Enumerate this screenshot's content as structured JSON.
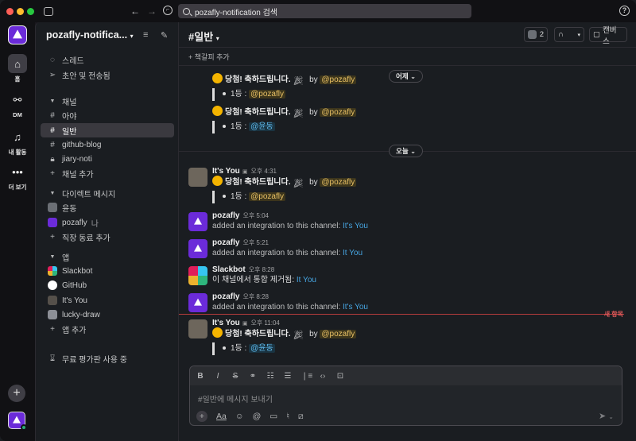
{
  "search": {
    "text": "pozafly-notification 검색"
  },
  "rail": {
    "items": [
      {
        "label": "홈",
        "icon": "home-icon"
      },
      {
        "label": "DM",
        "icon": "dm-icon"
      },
      {
        "label": "내 활동",
        "icon": "bell-icon"
      },
      {
        "label": "더 보기",
        "icon": "more-icon"
      }
    ]
  },
  "workspace": {
    "name": "pozafly-notifica...",
    "accent": "#6b2bd9"
  },
  "sidebar": {
    "threads": "스레드",
    "drafts": "초안 및 전송됨",
    "channels_header": "채널",
    "channels": [
      "아야",
      "일반",
      "github-blog",
      "jiary-noti"
    ],
    "add_channel": "채널 추가",
    "dm_header": "다이렉트 메시지",
    "dms": [
      "윤동",
      "pozafly"
    ],
    "me_tag": "나",
    "add_coworker": "직장 동료 추가",
    "apps_header": "앱",
    "apps": [
      "Slackbot",
      "GitHub",
      "It's You",
      "lucky-draw"
    ],
    "add_app": "앱 추가",
    "trial": "무료 평가판 사용 중"
  },
  "channel": {
    "name": "일반",
    "huddle_count": "2",
    "canvas": "캔버스",
    "bookmark": "책갈피 추가"
  },
  "pills": {
    "yesterday": "어제",
    "today": "오늘"
  },
  "messages": {
    "prev1": {
      "text": "당첨! 축하드립니다.",
      "by": "by",
      "mention": "@pozafly",
      "rank": "1등 :",
      "winner": "@pozafly"
    },
    "prev2": {
      "text": "당첨! 축하드립니다.",
      "by": "by",
      "mention": "@pozafly",
      "rank": "1등 :",
      "winner": "@윤동"
    },
    "m1": {
      "user": "It's You",
      "time": "오후 4:31",
      "text": "당첨! 축하드립니다.",
      "by": "by",
      "mention": "@pozafly",
      "rank": "1등 :",
      "winner": "@pozafly"
    },
    "m2": {
      "user": "pozafly",
      "time": "오후 5:04",
      "text": "added an integration to this channel:",
      "link": "It's You"
    },
    "m3": {
      "user": "pozafly",
      "time": "오후 5:21",
      "text": "added an integration to this channel:",
      "link": "It You"
    },
    "m4": {
      "user": "Slackbot",
      "time": "오후 8:28",
      "text": "이 채널에서 통합 제거됨:",
      "link": "It You"
    },
    "m5": {
      "user": "pozafly",
      "time": "오후 8:28",
      "text": "added an integration to this channel:",
      "link": "It's You"
    },
    "m6": {
      "user": "It's You",
      "time": "오후 11:04",
      "text": "당첨! 축하드립니다.",
      "by": "by",
      "mention": "@pozafly",
      "rank": "1등 :",
      "winner": "@윤동"
    }
  },
  "new_items": "새 항목",
  "composer": {
    "placeholder": "#일반에 메시지 보내기",
    "font_label": "Aa"
  }
}
